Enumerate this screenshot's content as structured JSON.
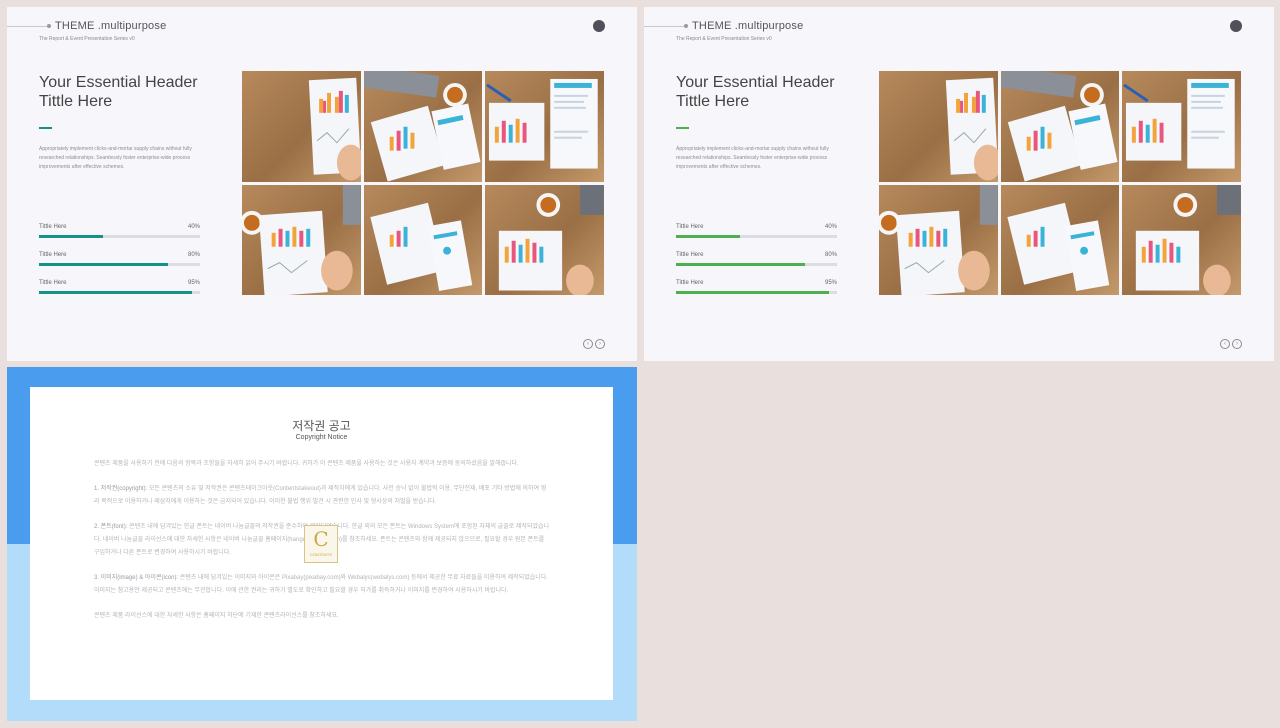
{
  "theme": {
    "title": "THEME .multipurpose",
    "subtitle": "The Report & Event Presentation Series v0"
  },
  "slide": {
    "header_line1": "Your Essential Header",
    "header_line2": "Tittle Here",
    "description": "Appropriately implement clicks-and-mortar supply chains without fully researched relationships. Seamlessly foster enterprise-wide process improvements after effective schemes.",
    "bars": [
      {
        "label": "Tittle Here",
        "percent_text": "40%",
        "value": 0.4
      },
      {
        "label": "Tittle Here",
        "percent_text": "80%",
        "value": 0.8
      },
      {
        "label": "Tittle Here",
        "percent_text": "95%",
        "value": 0.95
      }
    ]
  },
  "colors": {
    "slide1_accent": "#14928a",
    "slide2_accent": "#4caf50",
    "copyright_top": "#4a9cef",
    "copyright_bottom": "#b3dcfb"
  },
  "icons": {
    "prev": "‹",
    "next": "›"
  },
  "copyright": {
    "title": "저작권 공고",
    "subtitle": "Copyright Notice",
    "intro": "콘텐츠 제품을 사용하기 전에 다음의 항목과 조항들을 자세히 읽어 주시기 바랍니다. 귀하가 이 콘텐츠 제품을 사용하는 것은 사용자 계약과 보증에 동의하셨음을 말해줍니다.",
    "s1_head": "1. 저작권(copyright):",
    "s1_body": " 모든 콘텐츠의 소유 및 저작권은 콘텐츠테이크아웃(Contentstakeout)과 제작자에게 있습니다. 사전 승낙 없이 불법적 이용, 무단전재, 배포 기타 방법에 의하여 영리 목적으로 이용하거나 제삼자에게 이용하는 것은 금지되어 있습니다. 이러한 불법 행위 발견 시 관련한 민사 및 형사상의 처벌을 받습니다.",
    "s2_head": "2. 폰트(font):",
    "s2_body": " 콘텐츠 내에 담겨있는 한글 폰트는 네이버 나눔글꼴의 저작권을 준수하여 제작되었습니다. 한글 외의 모든 폰트는 Windows System에 포함된 자체의 글꼴로 제작되었습니다. 네이버 나눔글꼴 라이선스에 대한 자세한 사항은 네이버 나눔글꼴 홈페이지(hangeul.naver.com)를 참조하세요. 폰트는 콘텐츠와 함께 제공되지 않으므로, 필요할 경우 원본 폰트를 구입하거나 다른 폰트로 변경하여 사용하시기 바랍니다.",
    "s3_head": "3. 이미지(image) & 아이콘(icon):",
    "s3_body": " 콘텐츠 내에 담겨있는 이미지와 아이콘은 Pixabay(pixabay.com)와 Webalys(webalys.com) 등에서 제공한 무료 자료들을 이용하여 제작되었습니다. 이미지는 참고용만 제공되고 콘텐츠에는 무관합니다. 이에 관한 권리는 귀하가 별도로 확인하고 필요할 경우 허가를 취득하거나 이미지를 변경하여 사용하시기 바랍니다.",
    "outro": "콘텐츠 제품 라이선스에 대한 자세한 사항은 홈페이지 하단에 기재한 콘텐츠라이선스를 참조하세요.",
    "seal_letter": "C",
    "seal_text": "CONTENTS"
  }
}
